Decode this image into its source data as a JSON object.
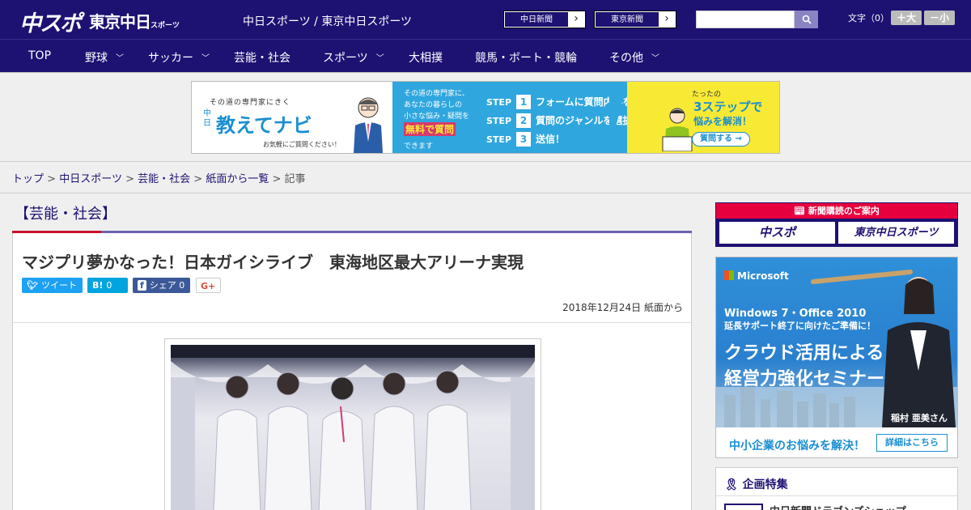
{
  "header": {
    "logo_chuspo": "中スポ",
    "logo_tokyo": "東京中日",
    "logo_tokyo_small": "スポーツ",
    "site_title": "中日スポーツ / 東京中日スポーツ",
    "paper_links": [
      {
        "label": "中日新聞"
      },
      {
        "label": "東京新聞"
      }
    ],
    "search_placeholder": "",
    "font_size_label": "文字（0）",
    "size_up": "＋大",
    "size_down": "－小"
  },
  "nav": {
    "items": [
      {
        "label": "TOP",
        "has_dropdown": false
      },
      {
        "label": "野球",
        "has_dropdown": true
      },
      {
        "label": "サッカー",
        "has_dropdown": true
      },
      {
        "label": "芸能・社会",
        "has_dropdown": false
      },
      {
        "label": "スポーツ",
        "has_dropdown": true
      },
      {
        "label": "大相撲",
        "has_dropdown": false
      },
      {
        "label": "競馬・ボート・競輪",
        "has_dropdown": false
      },
      {
        "label": "その他",
        "has_dropdown": true
      }
    ]
  },
  "banner_ad": {
    "sub": "その道の専門家にきく",
    "chu": "中日",
    "title": "教えてナビ",
    "foot": "お気軽にご質問ください！",
    "mid_text": "その道の専門家に、\nあなたの暮らしの\n小さな悩み・疑問を",
    "free": "無料で質問",
    "can": "できます",
    "steps": [
      {
        "num": "1",
        "text": "フォームに質問内容を入力"
      },
      {
        "num": "2",
        "text": "質問のジャンルを選択"
      },
      {
        "num": "3",
        "text": "送信！"
      }
    ],
    "step_word": "STEP",
    "right_text1": "たったの",
    "right_text2": "3ステップで",
    "right_text3": "悩みを解消！",
    "right_btn": "質問する →"
  },
  "breadcrumb": {
    "items": [
      "トップ",
      "中日スポーツ",
      "芸能・社会",
      "紙面から一覧"
    ],
    "current": "記事",
    "separator": ">"
  },
  "article": {
    "category": "【芸能・社会】",
    "title": "マジプリ夢かなった！日本ガイシライブ　東海地区最大アリーナ実現",
    "share": {
      "tweet": "ツイート",
      "hatena_icon": "B!",
      "hatena_count": "0",
      "facebook_icon": "f",
      "facebook": "シェア",
      "facebook_count": "0",
      "gplus": "G+"
    },
    "date": "2018年12月24日 紙面から"
  },
  "sidebar": {
    "subscribe_head": "新聞購読のご案内",
    "subscribe_btn1": "中スポ",
    "subscribe_btn2": "東京中日スポーツ",
    "ad": {
      "brand": "Microsoft",
      "line1": "Windows 7・Office 2010",
      "line2": "延長サポート終了に向けたご準備に！",
      "line3": "クラウド活用による",
      "line4": "経営力強化セミナー",
      "person": "稲村 亜美さん",
      "bottom_text": "中小企業のお悩みを解決！",
      "bottom_btn": "詳細はこちら"
    },
    "feature": {
      "head": "企画特集",
      "item": "中日新聞ドラゴンズショップ"
    }
  },
  "colors": {
    "brand_navy": "#1d1172",
    "accent_red": "#c8102e",
    "twitter": "#1da1f2",
    "hatena": "#00a4de",
    "facebook": "#3b5998"
  }
}
